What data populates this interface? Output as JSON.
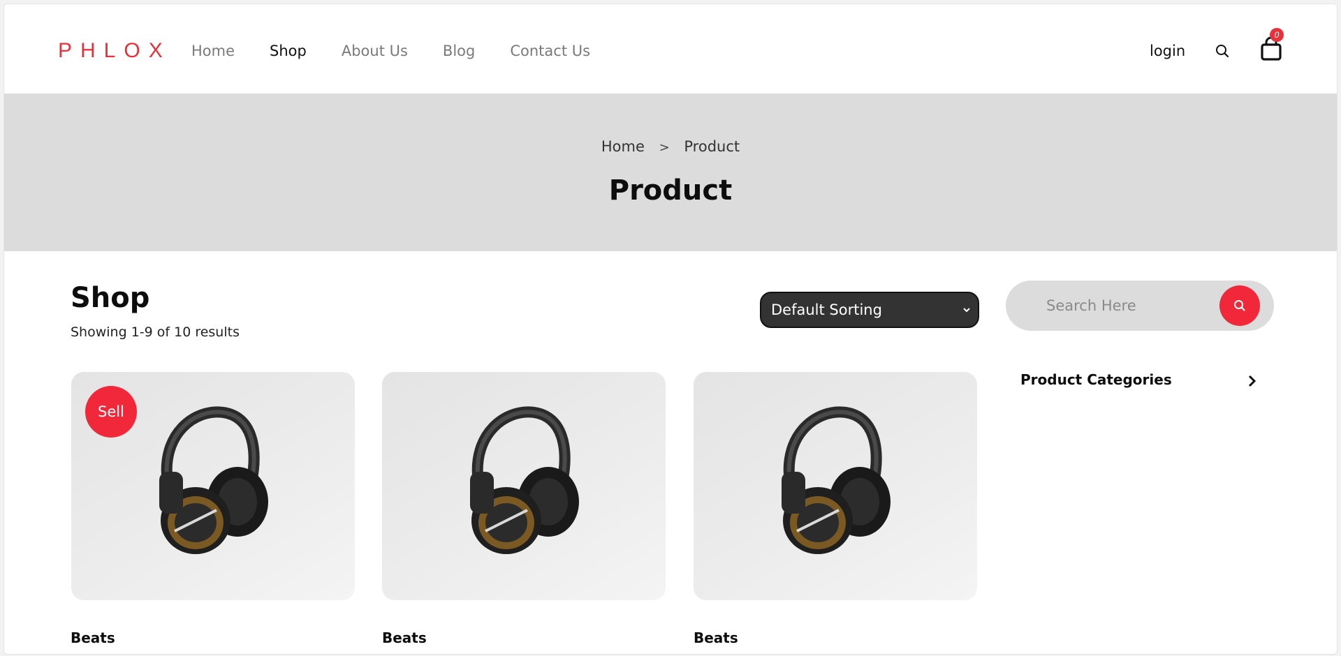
{
  "header": {
    "logo": "PHLOX",
    "nav": [
      {
        "label": "Home",
        "active": false
      },
      {
        "label": "Shop",
        "active": true
      },
      {
        "label": "About Us",
        "active": false
      },
      {
        "label": "Blog",
        "active": false
      },
      {
        "label": "Contact Us",
        "active": false
      }
    ],
    "login_label": "login",
    "cart_count": "0",
    "accent_color": "#e8323a"
  },
  "banner": {
    "breadcrumb": [
      "Home",
      ">",
      "Product"
    ],
    "title": "Product"
  },
  "shop": {
    "title": "Shop",
    "results_text": "Showing 1-9 of 10 results",
    "sort_selected": "Default Sorting"
  },
  "sidebar": {
    "search_placeholder": "Search Here",
    "categories_label": "Product Categories"
  },
  "products": [
    {
      "name": "Beats",
      "badge": "Sell",
      "image_icon": "headphones-icon"
    },
    {
      "name": "Beats",
      "badge": "",
      "image_icon": "headphones-icon"
    },
    {
      "name": "Beats",
      "badge": "",
      "image_icon": "headphones-icon"
    }
  ]
}
